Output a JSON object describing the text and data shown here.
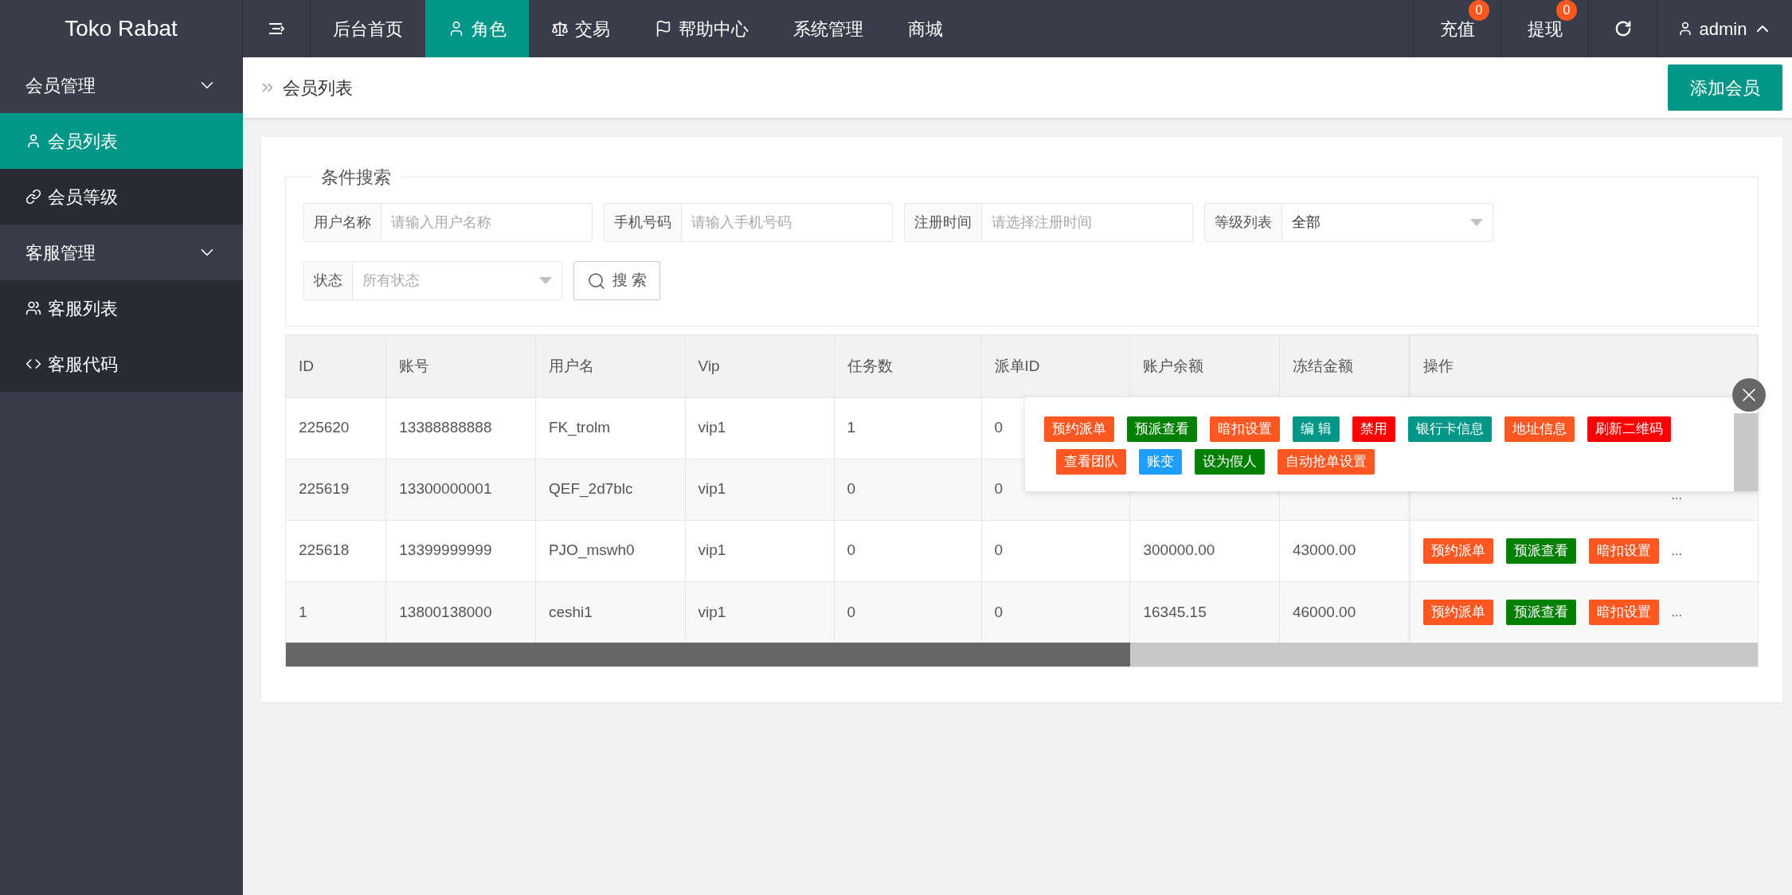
{
  "brand": "Toko Rabat",
  "nav": [
    {
      "label": "后台首页",
      "selected": false
    },
    {
      "label": "角色",
      "selected": true
    },
    {
      "label": "交易",
      "selected": false
    },
    {
      "label": "帮助中心",
      "selected": false
    },
    {
      "label": "系统管理",
      "selected": false
    },
    {
      "label": "商城",
      "selected": false
    }
  ],
  "top_right": [
    {
      "label": "充值",
      "badge": "0"
    },
    {
      "label": "提现",
      "badge": "0"
    }
  ],
  "user": "admin",
  "sidebar": [
    {
      "label": "会员管理",
      "expanded": true,
      "children": [
        {
          "label": "会员列表",
          "selected": true
        },
        {
          "label": "会员等级",
          "selected": false
        }
      ]
    },
    {
      "label": "客服管理",
      "expanded": true,
      "children": [
        {
          "label": "客服列表",
          "selected": false
        },
        {
          "label": "客服代码",
          "selected": false
        }
      ]
    }
  ],
  "breadcrumb": "会员列表",
  "add_button": "添加会员",
  "search": {
    "legend": "条件搜索",
    "fields": [
      {
        "kind": "input",
        "label": "用户名称",
        "placeholder": "请输入用户名称"
      },
      {
        "kind": "input",
        "label": "手机号码",
        "placeholder": "请输入手机号码"
      },
      {
        "kind": "input",
        "label": "注册时间",
        "placeholder": "请选择注册时间"
      },
      {
        "kind": "select",
        "label": "等级列表",
        "value": "全部"
      },
      {
        "kind": "select",
        "label": "状态",
        "placeholder": "所有状态"
      }
    ],
    "button": "搜 索"
  },
  "table": {
    "columns": [
      "ID",
      "账号",
      "用户名",
      "Vip",
      "任务数",
      "派单ID",
      "账户余额",
      "冻结金额",
      "操作"
    ],
    "rows": [
      {
        "cells": [
          "225620",
          "13388888888",
          "FK_trolm",
          "vip1",
          "1",
          "0"
        ]
      },
      {
        "cells": [
          "225619",
          "13300000001",
          "QEF_2d7blc",
          "vip1",
          "0",
          "0"
        ],
        "more": "..."
      },
      {
        "cells": [
          "225618",
          "13399999999",
          "PJO_mswh0",
          "vip1",
          "0",
          "0",
          "300000.00",
          "43000.00"
        ],
        "actions": [
          {
            "label": "预约派单",
            "color": "#ff5722"
          },
          {
            "label": "预派查看",
            "color": "#008000"
          },
          {
            "label": "暗扣设置",
            "color": "#ff5722"
          }
        ],
        "more": "..."
      },
      {
        "cells": [
          "1",
          "13800138000",
          "ceshi1",
          "vip1",
          "0",
          "0",
          "16345.15",
          "46000.00"
        ],
        "actions": [
          {
            "label": "预约派单",
            "color": "#ff5722"
          },
          {
            "label": "预派查看",
            "color": "#008000"
          },
          {
            "label": "暗扣设置",
            "color": "#ff5722"
          }
        ],
        "more": "..."
      }
    ]
  },
  "popup": {
    "actions": [
      {
        "label": "预约派单",
        "color": "#ff5722"
      },
      {
        "label": "预派查看",
        "color": "#008000"
      },
      {
        "label": "暗扣设置",
        "color": "#ff5722"
      },
      {
        "label": "编 辑",
        "color": "#009688"
      },
      {
        "label": "禁用",
        "color": "#ff0000"
      },
      {
        "label": "银行卡信息",
        "color": "#009688"
      },
      {
        "label": "地址信息",
        "color": "#ff5722"
      },
      {
        "label": "刷新二维码",
        "color": "#ff0000"
      },
      {
        "label": "查看团队",
        "color": "#ff5722"
      },
      {
        "label": "账变",
        "color": "#1e9fff"
      },
      {
        "label": "设为假人",
        "color": "#008000"
      },
      {
        "label": "自动抢单设置",
        "color": "#ff5722"
      }
    ]
  }
}
